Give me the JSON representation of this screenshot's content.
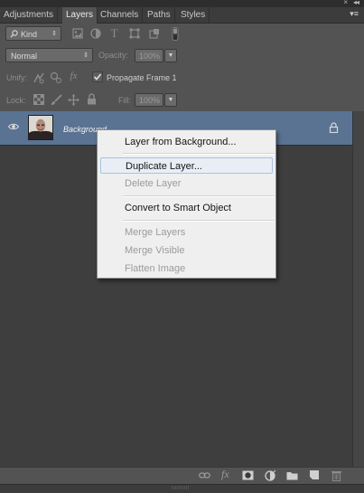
{
  "panel": {
    "tabs": [
      {
        "label": "Adjustments"
      },
      {
        "label": "Layers"
      },
      {
        "label": "Channels"
      },
      {
        "label": "Paths"
      },
      {
        "label": "Styles"
      }
    ],
    "active_tab": "Layers",
    "collapse_glyph": "◂◂",
    "close_glyph": "×"
  },
  "filter": {
    "kind_label": "Kind",
    "icons": [
      "pixel-filter-icon",
      "adjustment-filter-icon",
      "type-filter-icon",
      "shape-filter-icon",
      "smart-object-filter-icon",
      "filter-toggle-icon"
    ]
  },
  "blend": {
    "mode": "Normal",
    "opacity_label": "Opacity:",
    "opacity_value": "100%"
  },
  "unify": {
    "label": "Unify:",
    "propagate_label": "Propagate Frame 1",
    "propagate_checked": true
  },
  "lock": {
    "label": "Lock:",
    "fill_label": "Fill:",
    "fill_value": "100%"
  },
  "layers": [
    {
      "name": "Background",
      "visible": true,
      "locked": true,
      "selected": true
    }
  ],
  "context_menu": {
    "items": [
      {
        "label": "Layer from Background...",
        "enabled": true,
        "hover": false
      },
      {
        "label": "Duplicate Layer...",
        "enabled": true,
        "hover": true
      },
      {
        "label": "Delete Layer",
        "enabled": false,
        "hover": false
      },
      {
        "label": "Convert to Smart Object",
        "enabled": true,
        "hover": false
      },
      {
        "label": "Merge Layers",
        "enabled": false,
        "hover": false
      },
      {
        "label": "Merge Visible",
        "enabled": false,
        "hover": false
      },
      {
        "label": "Flatten Image",
        "enabled": false,
        "hover": false
      }
    ]
  },
  "bottom_icons": [
    "link-layers-icon",
    "fx-icon",
    "add-mask-icon",
    "adjustment-layer-icon",
    "new-group-icon",
    "new-layer-icon",
    "trash-icon"
  ],
  "colors": {
    "panel_bg": "#535353",
    "list_bg": "#3e3e3e",
    "selected_layer": "#5a7393",
    "menu_bg": "#efefef",
    "menu_hover": "#e9eef6"
  }
}
